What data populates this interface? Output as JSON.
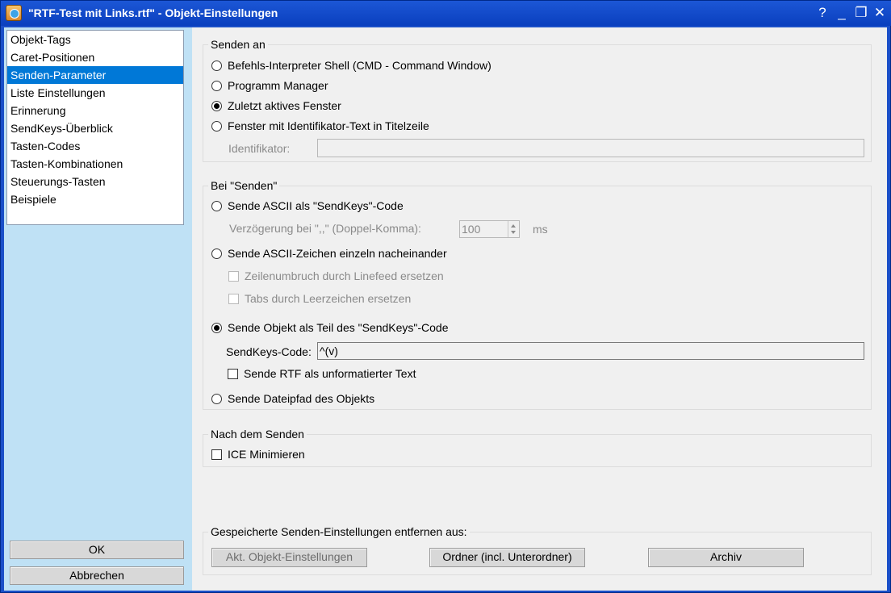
{
  "window": {
    "title": "\"RTF-Test mit Links.rtf\" - Objekt-Einstellungen",
    "help": "?",
    "minimize": "_",
    "restore": "❐",
    "close": "✕"
  },
  "sidebar": {
    "items": [
      {
        "label": "Objekt-Tags"
      },
      {
        "label": "Caret-Positionen"
      },
      {
        "label": "Senden-Parameter",
        "selected": true
      },
      {
        "label": "Liste Einstellungen"
      },
      {
        "label": "Erinnerung"
      },
      {
        "label": "SendKeys-Überblick"
      },
      {
        "label": "Tasten-Codes"
      },
      {
        "label": "Tasten-Kombinationen"
      },
      {
        "label": "Steuerungs-Tasten"
      },
      {
        "label": "Beispiele"
      }
    ],
    "ok_label": "OK",
    "cancel_label": "Abbrechen"
  },
  "send_to": {
    "title": "Senden an",
    "options": [
      {
        "label": "Befehls-Interpreter Shell (CMD - Command Window)",
        "checked": false
      },
      {
        "label": "Programm Manager",
        "checked": false
      },
      {
        "label": "Zuletzt aktives Fenster",
        "checked": true
      },
      {
        "label": "Fenster mit Identifikator-Text in Titelzeile",
        "checked": false
      }
    ],
    "identifier_label": "Identifikator:",
    "identifier_value": ""
  },
  "on_send": {
    "title": "Bei \"Senden\"",
    "ascii_sendkeys": {
      "label": "Sende ASCII als \"SendKeys\"-Code",
      "checked": false
    },
    "delay_label": "Verzögerung bei \",,\" (Doppel-Komma):",
    "delay_value": "100",
    "delay_unit": "ms",
    "ascii_single": {
      "label": "Sende ASCII-Zeichen einzeln nacheinander",
      "checked": false
    },
    "linefeed": {
      "label": "Zeilenumbruch durch Linefeed ersetzen",
      "checked": false
    },
    "tabs": {
      "label": "Tabs durch Leerzeichen ersetzen",
      "checked": false
    },
    "object_part": {
      "label": "Sende Objekt als Teil des \"SendKeys\"-Code",
      "checked": true
    },
    "sendkeys_label": "SendKeys-Code:",
    "sendkeys_value": "^(v)",
    "rtf_unformatted": {
      "label": "Sende RTF als unformatierter Text",
      "checked": false
    },
    "file_path": {
      "label": "Sende Dateipfad des Objekts",
      "checked": false
    }
  },
  "after_send": {
    "title": "Nach dem Senden",
    "minimize": {
      "label": "ICE Minimieren",
      "checked": false
    }
  },
  "remove_saved": {
    "title": "Gespeicherte Senden-Einstellungen entfernen aus:",
    "btn_object": "Akt. Objekt-Einstellungen",
    "btn_folder": "Ordner (incl. Unterordner)",
    "btn_archive": "Archiv"
  }
}
